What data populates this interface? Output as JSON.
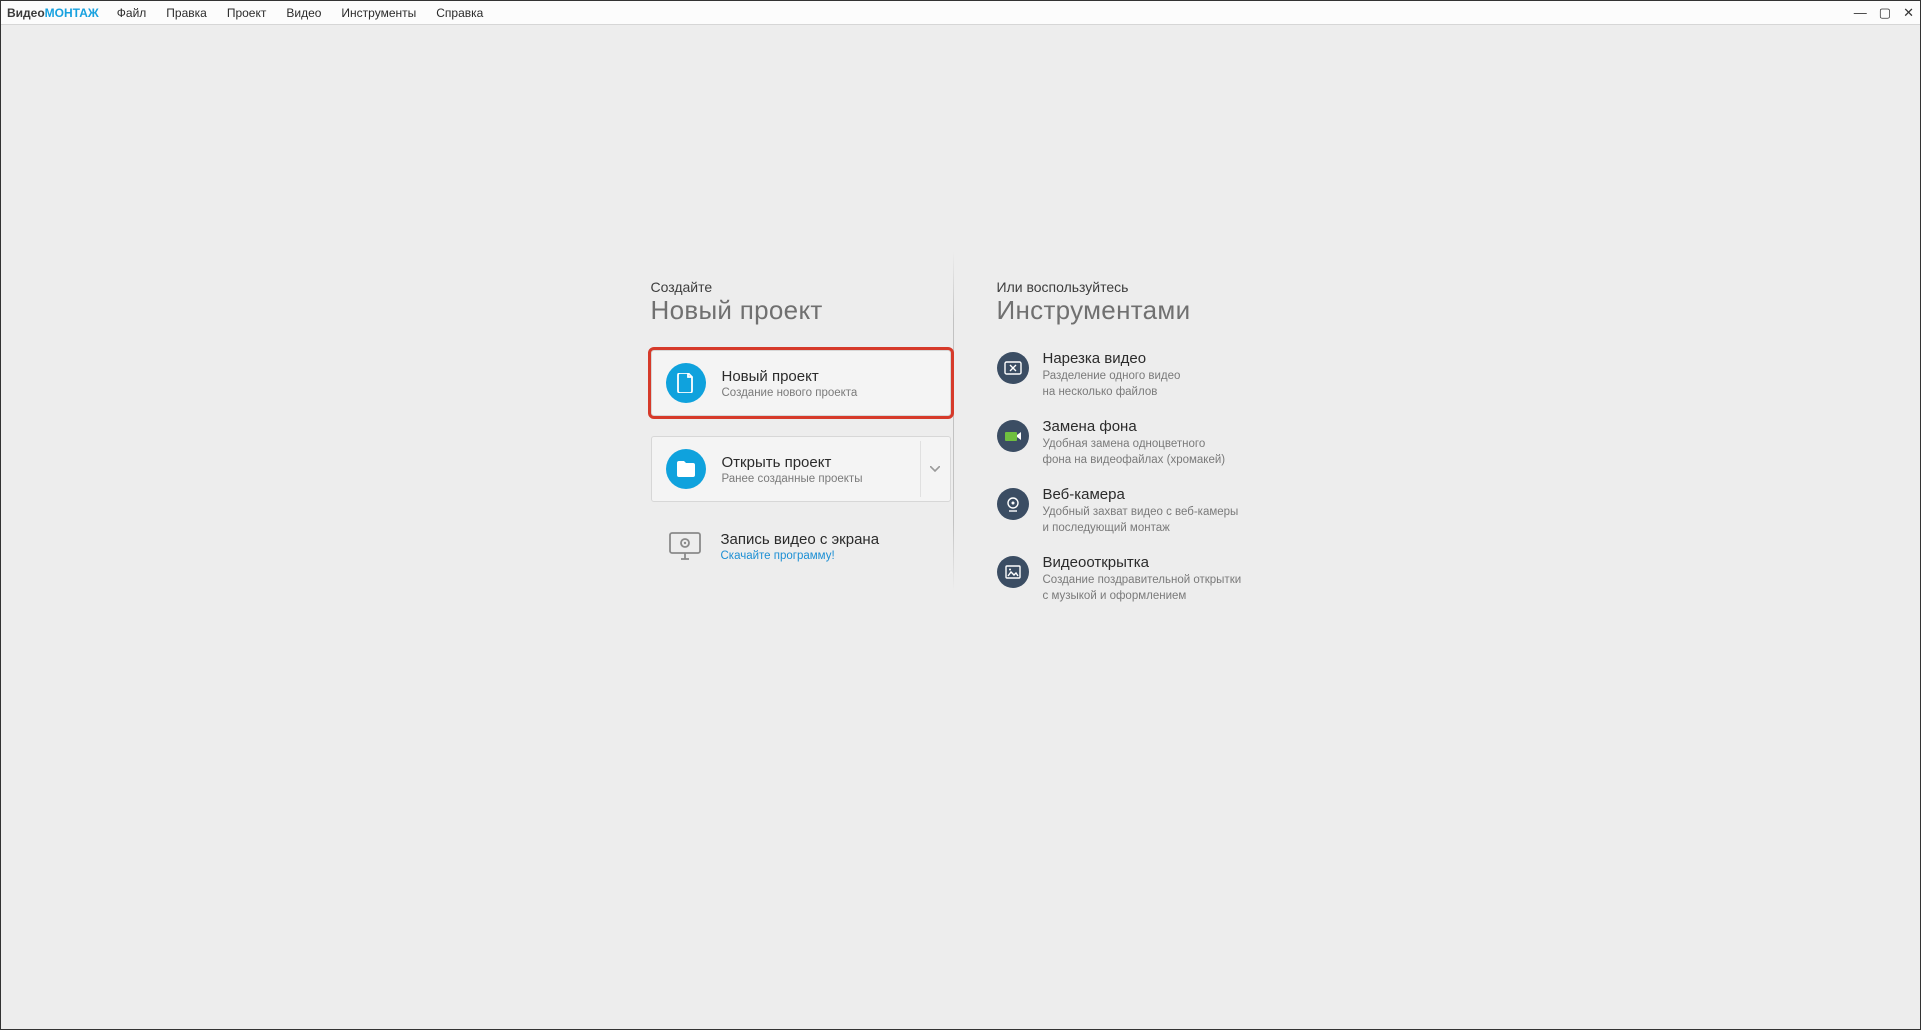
{
  "app": {
    "logo_part1": "Видео",
    "logo_part2": "МОНТАЖ"
  },
  "menu": {
    "items": [
      "Файл",
      "Правка",
      "Проект",
      "Видео",
      "Инструменты",
      "Справка"
    ]
  },
  "left": {
    "pretitle": "Создайте",
    "title": "Новый проект",
    "new_project": {
      "title": "Новый проект",
      "sub": "Создание нового проекта"
    },
    "open_project": {
      "title": "Открыть проект",
      "sub": "Ранее созданные проекты"
    },
    "screen_record": {
      "title": "Запись видео с экрана",
      "link": "Скачайте программу!"
    }
  },
  "right": {
    "pretitle": "Или воспользуйтесь",
    "title": "Инструментами",
    "tools": [
      {
        "title": "Нарезка видео",
        "sub": "Разделение одного видео\nна несколько файлов"
      },
      {
        "title": "Замена фона",
        "sub": "Удобная замена одноцветного\nфона на видеофайлах (хромакей)"
      },
      {
        "title": "Веб-камера",
        "sub": "Удобный захват видео с веб-камеры\nи последующий монтаж"
      },
      {
        "title": "Видеооткрытка",
        "sub": "Создание поздравительной открытки\nс музыкой и оформлением"
      }
    ]
  }
}
